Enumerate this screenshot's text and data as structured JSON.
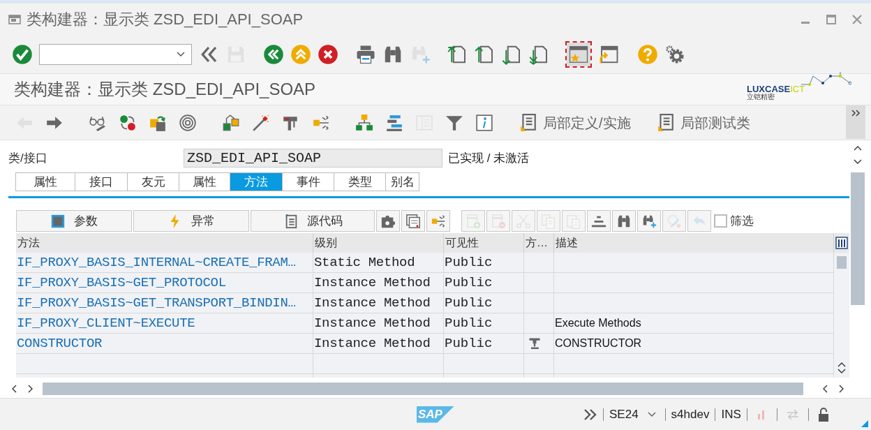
{
  "window": {
    "title": "类构建器：显示类 ZSD_EDI_API_SOAP"
  },
  "toolbar": [
    {
      "kind": "enter",
      "disabled": false
    },
    {
      "kind": "field"
    },
    {
      "kind": "back",
      "disabled": false
    },
    {
      "kind": "save",
      "disabled": true
    },
    {
      "kind": "gap"
    },
    {
      "kind": "exit",
      "disabled": false
    },
    {
      "kind": "up",
      "disabled": false
    },
    {
      "kind": "cancel",
      "disabled": false
    },
    {
      "kind": "gap"
    },
    {
      "kind": "print",
      "disabled": false
    },
    {
      "kind": "find",
      "disabled": false
    },
    {
      "kind": "findnext",
      "disabled": true
    },
    {
      "kind": "gap"
    },
    {
      "kind": "first",
      "disabled": false
    },
    {
      "kind": "prev",
      "disabled": false
    },
    {
      "kind": "next",
      "disabled": false
    },
    {
      "kind": "last",
      "disabled": false
    },
    {
      "kind": "gap"
    },
    {
      "kind": "layout",
      "selected": true
    },
    {
      "kind": "shortcut",
      "selected": false
    },
    {
      "kind": "gap"
    },
    {
      "kind": "help",
      "disabled": false
    },
    {
      "kind": "settings",
      "disabled": false
    }
  ],
  "screen_title": "类构建器：显示类 ZSD_EDI_API_SOAP",
  "logo": {
    "name": "LUXCASE",
    "suffix": "ICT",
    "subtitle": "立铠精密"
  },
  "app_toolbar": [
    {
      "kind": "left",
      "disabled": true
    },
    {
      "kind": "right",
      "disabled": false
    },
    {
      "kind": "gap"
    },
    {
      "kind": "glasses",
      "disabled": false
    },
    {
      "kind": "swap",
      "disabled": false
    },
    {
      "kind": "pack",
      "disabled": false
    },
    {
      "kind": "spiral",
      "disabled": false
    },
    {
      "kind": "gap"
    },
    {
      "kind": "hier",
      "disabled": false
    },
    {
      "kind": "wand",
      "disabled": false
    },
    {
      "kind": "pliers",
      "disabled": false
    },
    {
      "kind": "branch",
      "disabled": false
    },
    {
      "kind": "gap"
    },
    {
      "kind": "tree",
      "disabled": false
    },
    {
      "kind": "bars",
      "disabled": false
    },
    {
      "kind": "panel",
      "disabled": true
    },
    {
      "kind": "filter",
      "disabled": false
    },
    {
      "kind": "info",
      "disabled": false
    },
    {
      "kind": "text",
      "label": "局部定义/实施"
    },
    {
      "kind": "text",
      "label": "局部测试类"
    }
  ],
  "class_field": {
    "label": "类/接口",
    "value": "ZSD_EDI_API_SOAP",
    "status": "已实现 / 未激活"
  },
  "tabs": [
    {
      "label": "属性",
      "selected": false
    },
    {
      "label": "接口",
      "selected": false
    },
    {
      "label": "友元",
      "selected": false
    },
    {
      "label": "属性",
      "selected": false
    },
    {
      "label": "方法",
      "selected": true
    },
    {
      "label": "事件",
      "selected": false
    },
    {
      "label": "类型",
      "selected": false
    },
    {
      "label": "别名",
      "selected": false
    }
  ],
  "grid_toolbar": {
    "buttons": [
      {
        "kind": "params",
        "label": "参数"
      },
      {
        "kind": "exceptions",
        "label": "异常"
      },
      {
        "kind": "source",
        "label": "源代码"
      }
    ],
    "tools": [
      {
        "kind": "puzzle",
        "disabled": false
      },
      {
        "kind": "panel2",
        "disabled": false
      },
      {
        "kind": "branch",
        "disabled": false
      },
      {
        "kind": "gap"
      },
      {
        "kind": "addrow",
        "disabled": true
      },
      {
        "kind": "delrow",
        "disabled": true
      },
      {
        "kind": "cut",
        "disabled": true
      },
      {
        "kind": "copy",
        "disabled": true
      },
      {
        "kind": "paste",
        "disabled": true
      },
      {
        "kind": "sort",
        "disabled": false
      },
      {
        "kind": "find",
        "disabled": false
      },
      {
        "kind": "findnext",
        "disabled": false
      },
      {
        "kind": "gearedit",
        "disabled": true
      },
      {
        "kind": "undo",
        "disabled": true
      }
    ],
    "filter": {
      "label": "筛选",
      "checked": false
    }
  },
  "table": {
    "columns": [
      "方法",
      "级别",
      "可见性",
      "方…",
      "描述"
    ],
    "rows": [
      {
        "method": "IF_PROXY_BASIS_INTERNAL~CREATE_FRAM…",
        "level": "Static Method",
        "visibility": "Public",
        "kind": "method"
      },
      {
        "method": "IF_PROXY_BASIS~GET_PROTOCOL",
        "level": "Instance Method",
        "visibility": "Public",
        "kind": "method"
      },
      {
        "method": "IF_PROXY_BASIS~GET_TRANSPORT_BINDIN…",
        "level": "Instance Method",
        "visibility": "Public",
        "kind": "method"
      },
      {
        "method": "IF_PROXY_CLIENT~EXECUTE",
        "level": "Instance Method",
        "visibility": "Public",
        "kind": "method",
        "description": "Execute Methods"
      },
      {
        "method": "CONSTRUCTOR",
        "level": "Instance Method",
        "visibility": "Public",
        "kind": "constructor",
        "description": "CONSTRUCTOR"
      }
    ]
  },
  "status_bar": {
    "logo": "SAP",
    "transaction": "SE24",
    "system": "s4hdev",
    "mode": "INS"
  }
}
